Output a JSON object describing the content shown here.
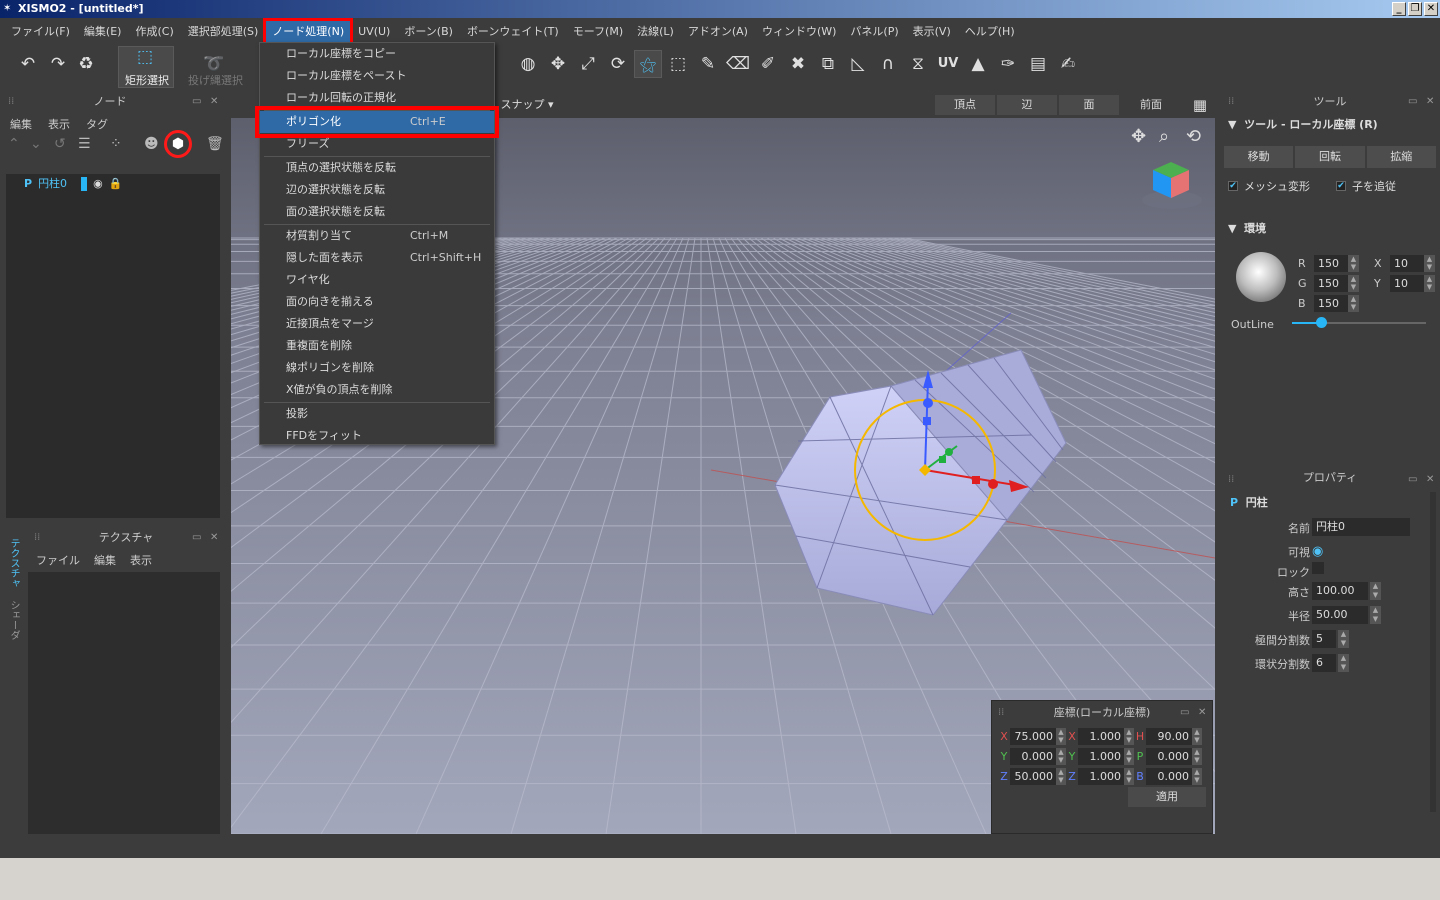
{
  "window": {
    "title": "XISMO2 - [untitled*]"
  },
  "menubar": {
    "items": [
      "ファイル(F)",
      "編集(E)",
      "作成(C)",
      "選択部処理(S)",
      "ノード処理(N)",
      "UV(U)",
      "ボーン(B)",
      "ボーンウェイト(T)",
      "モーフ(M)",
      "法線(L)",
      "アドオン(A)",
      "ウィンドウ(W)",
      "パネル(P)",
      "表示(V)",
      "ヘルプ(H)"
    ],
    "active_index": 4
  },
  "toolbar": {
    "rect_select_label": "矩形選択",
    "lasso_select_label": "投げ縄選択"
  },
  "dropdown": {
    "items": [
      {
        "label": "ローカル座標をコピー",
        "shortcut": ""
      },
      {
        "label": "ローカル座標をペースト",
        "shortcut": ""
      },
      {
        "label": "ローカル回転の正規化",
        "shortcut": ""
      },
      {
        "label": "ポリゴン化",
        "shortcut": "Ctrl+E"
      },
      {
        "label": "フリーズ",
        "shortcut": ""
      },
      {
        "label": "頂点の選択状態を反転",
        "shortcut": ""
      },
      {
        "label": "辺の選択状態を反転",
        "shortcut": ""
      },
      {
        "label": "面の選択状態を反転",
        "shortcut": ""
      },
      {
        "label": "材質割り当て",
        "shortcut": "Ctrl+M"
      },
      {
        "label": "隠した面を表示",
        "shortcut": "Ctrl+Shift+H"
      },
      {
        "label": "ワイヤ化",
        "shortcut": ""
      },
      {
        "label": "面の向きを揃える",
        "shortcut": ""
      },
      {
        "label": "近接頂点をマージ",
        "shortcut": ""
      },
      {
        "label": "重複面を削除",
        "shortcut": ""
      },
      {
        "label": "線ポリゴンを削除",
        "shortcut": ""
      },
      {
        "label": "X値が負の頂点を削除",
        "shortcut": ""
      },
      {
        "label": "投影",
        "shortcut": ""
      },
      {
        "label": "FFDをフィット",
        "shortcut": ""
      }
    ],
    "highlight_index": 3
  },
  "node_panel": {
    "title": "ノード",
    "tabs": [
      "編集",
      "表示",
      "タグ"
    ],
    "tree": {
      "node_name": "円柱0"
    }
  },
  "texture_panel": {
    "title": "テクスチャ",
    "tabs": [
      "ファイル",
      "編集",
      "表示"
    ],
    "side_tabs": [
      "テクスチャ",
      "シェーダ"
    ]
  },
  "viewport": {
    "snap_label": "スナップ",
    "mode_tabs": [
      "頂点",
      "辺",
      "面"
    ],
    "view_label": "前面"
  },
  "tool_panel": {
    "title": "ツール",
    "subtitle": "ツール - ローカル座標 (R)",
    "buttons": [
      "移動",
      "回転",
      "拡縮"
    ],
    "mesh_deform": "メッシュ変形",
    "follow_children": "子を追従",
    "env_title": "環境",
    "rgb": {
      "R": "150",
      "G": "150",
      "B": "150"
    },
    "xy": {
      "X": "10",
      "Y": "10"
    },
    "outline_label": "OutLine",
    "outline_value": 0.22
  },
  "property_panel": {
    "title": "プロパティ",
    "object_label": "円柱",
    "name_label": "名前",
    "name_value": "円柱0",
    "visible_label": "可視",
    "lock_label": "ロック",
    "height_label": "高さ",
    "height_value": "100.00",
    "radius_label": "半径",
    "radius_value": "50.00",
    "axial_div_label": "極間分割数",
    "axial_div_value": "5",
    "ring_div_label": "環状分割数",
    "ring_div_value": "6"
  },
  "coord_panel": {
    "title": "座標(ローカル座標)",
    "pos": {
      "X": "75.000",
      "Y": "0.000",
      "Z": "50.000"
    },
    "scale": {
      "X": "1.000",
      "Y": "1.000",
      "Z": "1.000"
    },
    "rot": {
      "H": "90.00",
      "P": "0.000",
      "B": "0.000"
    },
    "apply_label": "適用"
  },
  "colors": {
    "accent": "#2f6aa7",
    "highlight_box": "#ff0000",
    "selection_cyan": "#29b6f6",
    "mesh": "#b7b9e8",
    "gizmo_ring": "#f5b800"
  }
}
